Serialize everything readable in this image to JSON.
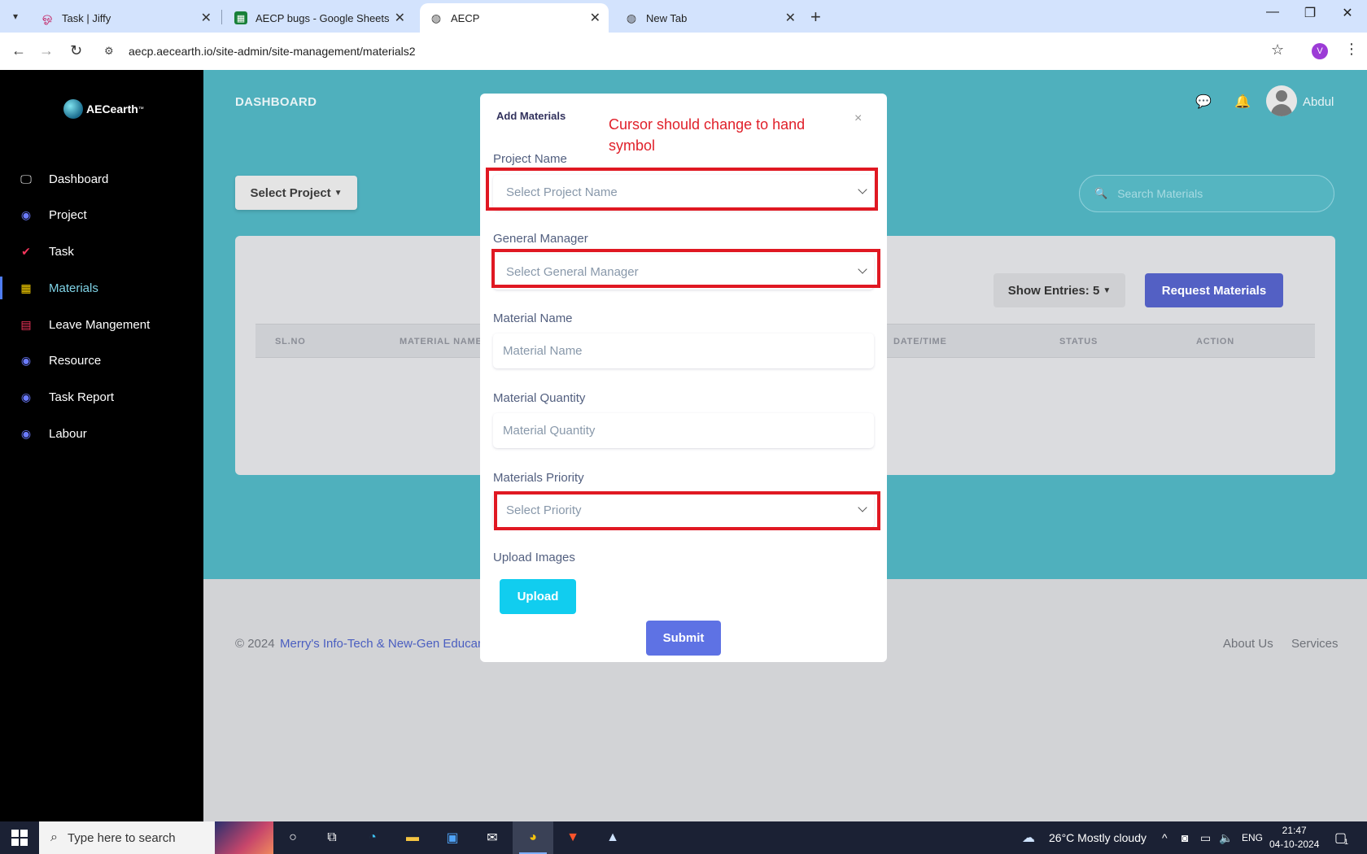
{
  "browser": {
    "tabs": [
      {
        "title": "Task | Jiffy",
        "favicon": "jiffy-icon"
      },
      {
        "title": "AECP bugs - Google Sheets",
        "favicon": "sheets-icon"
      },
      {
        "title": "AECP",
        "favicon": "globe-icon",
        "active": true
      },
      {
        "title": "New Tab",
        "favicon": "chrome-icon"
      }
    ],
    "url": "aecp.aecearth.io/site-admin/site-management/materials2",
    "profile_initial": "V"
  },
  "sidebar": {
    "logo_text": "AECearth",
    "logo_tm": "™",
    "items": [
      {
        "label": "Dashboard",
        "icon": "monitor-icon"
      },
      {
        "label": "Project",
        "icon": "globe-icon"
      },
      {
        "label": "Task",
        "icon": "check-icon"
      },
      {
        "label": "Materials",
        "icon": "materials-icon",
        "active": true
      },
      {
        "label": "Leave Mangement",
        "icon": "leave-icon"
      },
      {
        "label": "Resource",
        "icon": "globe-icon"
      },
      {
        "label": "Task Report",
        "icon": "globe-icon"
      },
      {
        "label": "Labour",
        "icon": "globe-icon"
      }
    ]
  },
  "header": {
    "title": "DASHBOARD",
    "username": "Abdul"
  },
  "main": {
    "select_project": "Select Project",
    "search_placeholder": "Search Materials",
    "show_entries": "Show Entries: 5",
    "request_button": "Request Materials",
    "columns": [
      "SL.NO",
      "MATERIAL NAME",
      "DATE/TIME",
      "STATUS",
      "ACTION"
    ]
  },
  "footer": {
    "copyright": "© 2024",
    "company": "Merry's Info-Tech & New-Gen Educar",
    "links": [
      "About Us",
      "Services"
    ]
  },
  "modal": {
    "title": "Add Materials",
    "close": "×",
    "annotation": "Cursor should change to hand symbol",
    "fields": {
      "project_label": "Project Name",
      "project_placeholder": "Select Project Name",
      "manager_label": "General Manager",
      "manager_placeholder": "Select General Manager",
      "material_name_label": "Material Name",
      "material_name_placeholder": "Material Name",
      "quantity_label": "Material Quantity",
      "quantity_placeholder": "Material Quantity",
      "priority_label": "Materials Priority",
      "priority_placeholder": "Select Priority",
      "upload_label": "Upload Images"
    },
    "upload_button": "Upload",
    "submit_button": "Submit"
  },
  "taskbar": {
    "search_placeholder": "Type here to search",
    "weather": "26°C  Mostly cloudy",
    "language": "ENG",
    "time": "21:47",
    "date": "04-10-2024",
    "notification_count": "1"
  },
  "colors": {
    "accent_teal": "#4fb0bd",
    "request_button": "#5360c4",
    "submit_button": "#5e72e4",
    "upload_button": "#11cdef",
    "annotation_red": "#e01822"
  }
}
